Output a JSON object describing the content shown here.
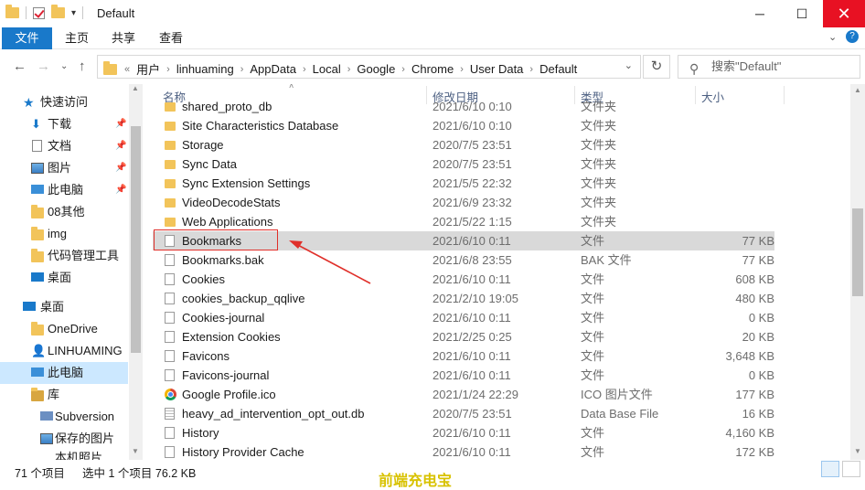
{
  "window": {
    "title": "Default"
  },
  "ribbon": {
    "tabs": [
      "文件",
      "主页",
      "共享",
      "查看"
    ]
  },
  "address": {
    "crumbs": [
      "用户",
      "linhuaming",
      "AppData",
      "Local",
      "Google",
      "Chrome",
      "User Data",
      "Default"
    ],
    "search_placeholder": "搜索\"Default\""
  },
  "nav": {
    "items": [
      {
        "label": "快速访问",
        "icon": "star-icon"
      },
      {
        "label": "下载",
        "icon": "download-icon",
        "pinned": true
      },
      {
        "label": "文档",
        "icon": "document-icon",
        "pinned": true
      },
      {
        "label": "图片",
        "icon": "picture-icon",
        "pinned": true
      },
      {
        "label": "此电脑",
        "icon": "computer-icon",
        "pinned": true
      },
      {
        "label": "08其他",
        "icon": "folder-icon"
      },
      {
        "label": "img",
        "icon": "folder-icon"
      },
      {
        "label": "代码管理工具",
        "icon": "folder-icon"
      },
      {
        "label": "桌面",
        "icon": "desktop-icon"
      },
      {
        "label": "桌面",
        "icon": "desktop-icon"
      },
      {
        "label": "OneDrive",
        "icon": "folder-icon"
      },
      {
        "label": "LINHUAMING",
        "icon": "user-icon"
      },
      {
        "label": "此电脑",
        "icon": "computer-icon",
        "selected": true
      },
      {
        "label": "库",
        "icon": "library-icon"
      },
      {
        "label": "Subversion",
        "icon": "svn-icon"
      },
      {
        "label": "保存的图片",
        "icon": "picture-icon"
      },
      {
        "label": "本机照片",
        "icon": "picture-icon"
      }
    ]
  },
  "columns": {
    "name": "名称",
    "date": "修改日期",
    "type": "类型",
    "size": "大小"
  },
  "files": [
    {
      "name": "shared_proto_db",
      "date": "2021/6/10 0:10",
      "type": "文件夹",
      "size": "",
      "icon": "folder-icon"
    },
    {
      "name": "Site Characteristics Database",
      "date": "2021/6/10 0:10",
      "type": "文件夹",
      "size": "",
      "icon": "folder-icon"
    },
    {
      "name": "Storage",
      "date": "2020/7/5 23:51",
      "type": "文件夹",
      "size": "",
      "icon": "folder-icon"
    },
    {
      "name": "Sync Data",
      "date": "2020/7/5 23:51",
      "type": "文件夹",
      "size": "",
      "icon": "folder-icon"
    },
    {
      "name": "Sync Extension Settings",
      "date": "2021/5/5 22:32",
      "type": "文件夹",
      "size": "",
      "icon": "folder-icon"
    },
    {
      "name": "VideoDecodeStats",
      "date": "2021/6/9 23:32",
      "type": "文件夹",
      "size": "",
      "icon": "folder-icon"
    },
    {
      "name": "Web Applications",
      "date": "2021/5/22 1:15",
      "type": "文件夹",
      "size": "",
      "icon": "folder-icon"
    },
    {
      "name": "Bookmarks",
      "date": "2021/6/10 0:11",
      "type": "文件",
      "size": "77 KB",
      "icon": "file-icon",
      "selected": true
    },
    {
      "name": "Bookmarks.bak",
      "date": "2021/6/8 23:55",
      "type": "BAK 文件",
      "size": "77 KB",
      "icon": "file-icon"
    },
    {
      "name": "Cookies",
      "date": "2021/6/10 0:11",
      "type": "文件",
      "size": "608 KB",
      "icon": "file-icon"
    },
    {
      "name": "cookies_backup_qqlive",
      "date": "2021/2/10 19:05",
      "type": "文件",
      "size": "480 KB",
      "icon": "file-icon"
    },
    {
      "name": "Cookies-journal",
      "date": "2021/6/10 0:11",
      "type": "文件",
      "size": "0 KB",
      "icon": "file-icon"
    },
    {
      "name": "Extension Cookies",
      "date": "2021/2/25 0:25",
      "type": "文件",
      "size": "20 KB",
      "icon": "file-icon"
    },
    {
      "name": "Favicons",
      "date": "2021/6/10 0:11",
      "type": "文件",
      "size": "3,648 KB",
      "icon": "file-icon"
    },
    {
      "name": "Favicons-journal",
      "date": "2021/6/10 0:11",
      "type": "文件",
      "size": "0 KB",
      "icon": "file-icon"
    },
    {
      "name": "Google Profile.ico",
      "date": "2021/1/24 22:29",
      "type": "ICO 图片文件",
      "size": "177 KB",
      "icon": "chrome-icon"
    },
    {
      "name": "heavy_ad_intervention_opt_out.db",
      "date": "2020/7/5 23:51",
      "type": "Data Base File",
      "size": "16 KB",
      "icon": "database-file-icon"
    },
    {
      "name": "History",
      "date": "2021/6/10 0:11",
      "type": "文件",
      "size": "4,160 KB",
      "icon": "file-icon"
    },
    {
      "name": "History Provider Cache",
      "date": "2021/6/10 0:11",
      "type": "文件",
      "size": "172 KB",
      "icon": "file-icon"
    }
  ],
  "status": {
    "count": "71 个项目",
    "selection": "选中 1 个项目  76.2 KB"
  },
  "watermark": "前端充电宝"
}
